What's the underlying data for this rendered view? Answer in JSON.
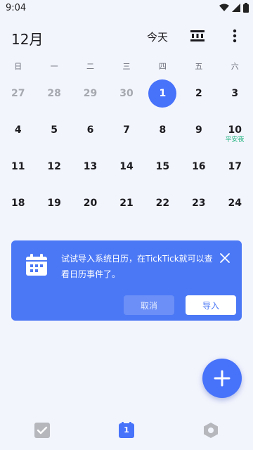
{
  "status_bar": {
    "time": "9:04"
  },
  "header": {
    "month": "12月",
    "today_label": "今天"
  },
  "weekdays": [
    "日",
    "一",
    "二",
    "三",
    "四",
    "五",
    "六"
  ],
  "calendar": {
    "rows": [
      [
        "27",
        "28",
        "29",
        "30",
        "1",
        "2",
        "3"
      ],
      [
        "4",
        "5",
        "6",
        "7",
        "8",
        "9",
        "10"
      ],
      [
        "11",
        "12",
        "13",
        "14",
        "15",
        "16",
        "17"
      ],
      [
        "18",
        "19",
        "20",
        "21",
        "22",
        "23",
        "24"
      ]
    ],
    "selected_day": "1",
    "holiday_label": "平安夜"
  },
  "banner": {
    "text": "试试导入系统日历，在TickTick就可以查看日历事件了。",
    "cancel_label": "取消",
    "import_label": "导入"
  },
  "bottom_nav": {
    "calendar_badge": "1"
  },
  "colors": {
    "accent": "#4772fa",
    "banner_bg": "#4b78f5",
    "holiday": "#1fb37d",
    "muted_day": "#a7a9b0"
  },
  "icons": {
    "status": [
      "wifi-icon",
      "signal-icon",
      "battery-icon"
    ],
    "header": [
      "view-toggle-icon",
      "more-vert-icon"
    ],
    "banner": [
      "calendar-icon",
      "close-icon"
    ],
    "fab": "plus-icon",
    "nav": [
      "task-check-icon",
      "calendar-tab-icon",
      "settings-hex-icon"
    ]
  }
}
